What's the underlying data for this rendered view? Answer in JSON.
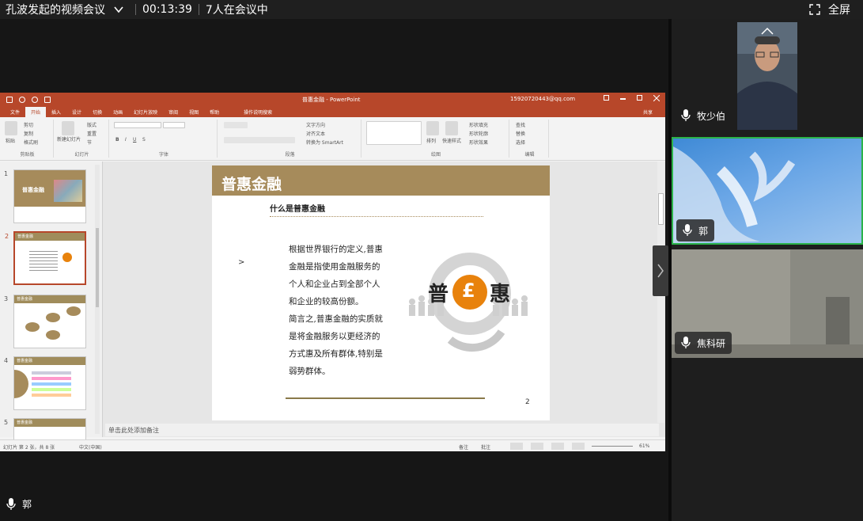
{
  "topbar": {
    "meeting_title": "孔波发起的视频会议",
    "elapsed": "00:13:39",
    "participants_text": "7人在会议中",
    "fullscreen_label": "全屏"
  },
  "ppt": {
    "window_title": "普惠金融 - PowerPoint",
    "account": "15920720443@qq.com",
    "tabs": [
      "文件",
      "开始",
      "插入",
      "设计",
      "切换",
      "动画",
      "幻灯片放映",
      "审阅",
      "视图",
      "帮助"
    ],
    "active_tab_index": 1,
    "search_placeholder": "操作说明搜索",
    "share_label": "共享",
    "ribbon_groups": [
      "剪贴板",
      "幻灯片",
      "字体",
      "段落",
      "绘图",
      "编辑"
    ],
    "ribbon_buttons": {
      "paste": "粘贴",
      "cut": "剪切",
      "copy": "复制",
      "format_painter": "格式刷",
      "new_slide": "新建幻灯片",
      "layout": "版式",
      "reset": "重置",
      "section": "节",
      "text_direction": "文字方向",
      "align_text": "对齐文本",
      "smartart": "转换为 SmartArt",
      "arrange": "排列",
      "quick_styles": "快速样式",
      "shape_fill": "形状填充",
      "shape_outline": "形状轮廓",
      "shape_effects": "形状效果",
      "find": "查找",
      "replace": "替换",
      "select": "选择"
    },
    "thumbnails": [
      {
        "num": "1",
        "title": "普惠金融"
      },
      {
        "num": "2",
        "title": "普惠金融"
      },
      {
        "num": "3",
        "title": "普惠金融"
      },
      {
        "num": "4",
        "title": "普惠金融"
      },
      {
        "num": "5",
        "title": "普惠金融"
      }
    ],
    "active_slide_index": 1,
    "slide": {
      "title": "普惠金融",
      "subtitle": "什么是普惠金融",
      "body_lines": [
        "根据世界银行的定义,普惠",
        "金融是指使用金融服务的",
        "个人和企业占到全部个人",
        "和企业的较高份额。",
        "简言之,普惠金融的实质就",
        "是将金融服务以更经济的",
        "方式惠及所有群体,特别是",
        "弱势群体。"
      ],
      "logo_left": "普",
      "logo_center": "£",
      "logo_right": "惠",
      "page_number": "2"
    },
    "notes_placeholder": "单击此处添加备注",
    "status": {
      "slide_info": "幻灯片 第 2 张，共 8 张",
      "language": "中文(中国)",
      "notes": "备注",
      "comments": "批注",
      "zoom": "61%"
    },
    "colors": {
      "accent": "#b7472a",
      "slide_band": "#a68b5b",
      "logo_orange": "#e8820c"
    }
  },
  "local_user": {
    "name": "郭"
  },
  "participants": [
    {
      "name": "牧少伯",
      "speaking": false
    },
    {
      "name": "郭",
      "speaking": true
    },
    {
      "name": "焦科研",
      "speaking": false
    }
  ]
}
